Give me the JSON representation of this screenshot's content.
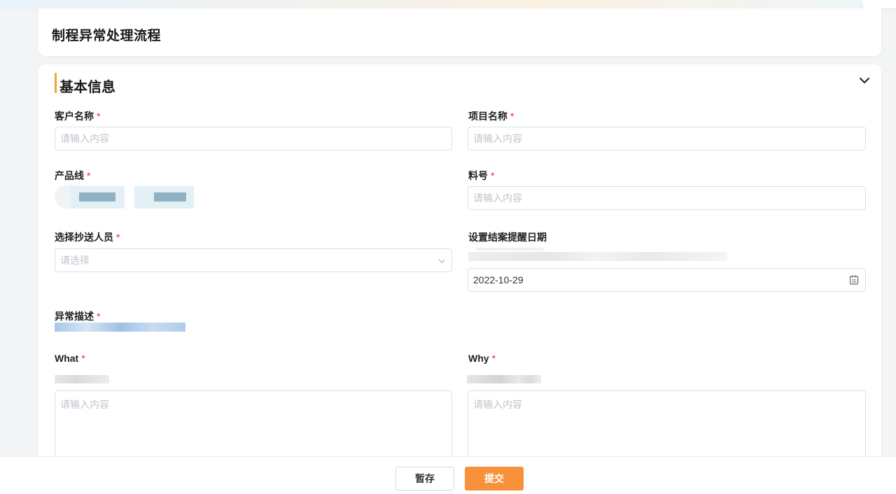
{
  "page": {
    "title": "制程异常处理流程"
  },
  "section": {
    "title": "基本信息"
  },
  "fields": {
    "customer_name": {
      "label": "客户名称",
      "required": "*",
      "placeholder": "请输入内容"
    },
    "project_name": {
      "label": "项目名称",
      "required": "*",
      "placeholder": "请输入内容"
    },
    "product_line": {
      "label": "产品线",
      "required": "*"
    },
    "material_no": {
      "label": "料号",
      "required": "*",
      "placeholder": "请输入内容"
    },
    "cc_person": {
      "label": "选择抄送人员",
      "required": "*",
      "placeholder": "请选择"
    },
    "reminder_date": {
      "label": "设置结案提醒日期",
      "value": "2022-10-29"
    },
    "abnormal_desc": {
      "label": "异常描述",
      "required": "*"
    },
    "what": {
      "label": "What",
      "required": "*",
      "placeholder": "请输入内容"
    },
    "why": {
      "label": "Why",
      "required": "*",
      "placeholder": "请输入内容"
    }
  },
  "footer": {
    "save_label": "暂存",
    "submit_label": "提交"
  },
  "colors": {
    "accent": "#f7a234",
    "primary_button": "#f7923a",
    "required_star": "#f5222d"
  },
  "icons": {
    "collapse": "chevron-down-icon",
    "select_arrow": "chevron-down-icon",
    "date": "calendar-icon"
  }
}
